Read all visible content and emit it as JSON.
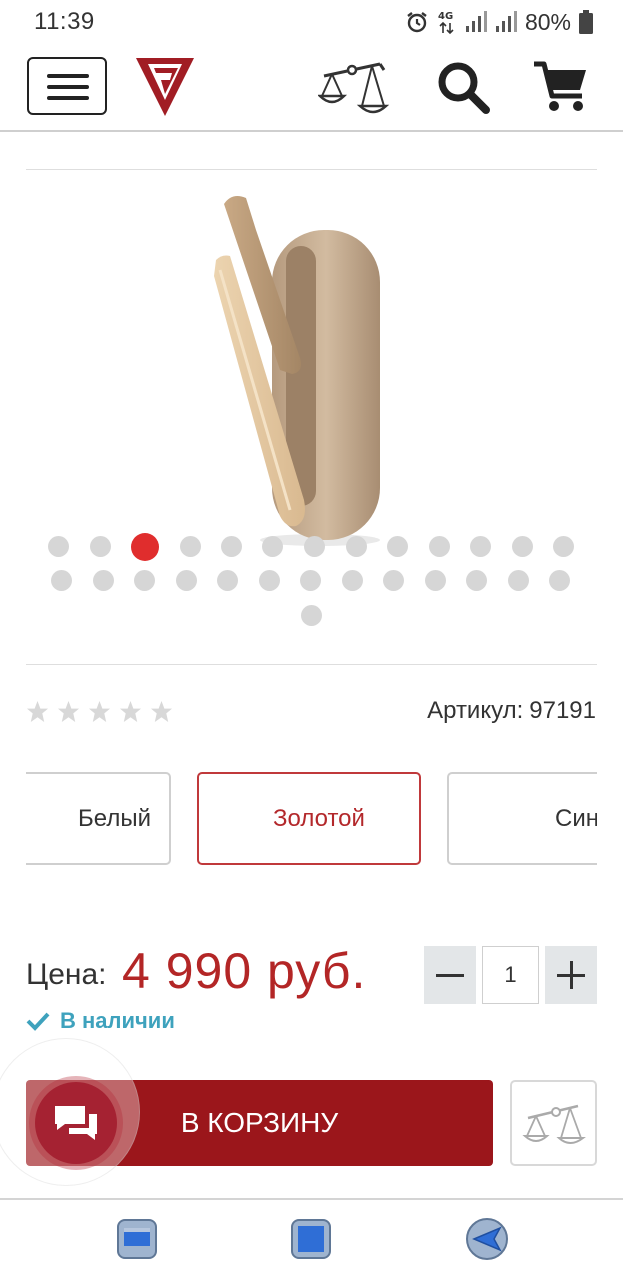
{
  "status_bar": {
    "time": "11:39",
    "network": "4G",
    "battery": "80%",
    "icons": [
      "alarm-icon",
      "signal-icon",
      "signal-icon",
      "battery-icon"
    ]
  },
  "header": {
    "icons": [
      "menu-icon",
      "logo",
      "compare-scales-icon",
      "search-icon",
      "cart-icon"
    ]
  },
  "gallery": {
    "total_slides": 27,
    "active_index": 2,
    "dots_per_row": [
      13,
      13,
      1
    ]
  },
  "product": {
    "rating_stars": 5,
    "rating_value": 0,
    "article_label": "Артикул:",
    "article_value": "97191"
  },
  "variants": [
    {
      "label": "Белый",
      "selected": false
    },
    {
      "label": "Золотой",
      "selected": true
    },
    {
      "label": "Син",
      "selected": false
    }
  ],
  "price": {
    "label": "Цена:",
    "value": "4 990 руб."
  },
  "quantity": {
    "value": "1"
  },
  "availability": {
    "text": "В наличии"
  },
  "actions": {
    "add_to_cart_label": "В КОРЗИНУ"
  },
  "colors": {
    "accent_red": "#9b161b",
    "price_red": "#b32626",
    "active_dot": "#e02d2d",
    "availability_blue": "#3ea2bd"
  }
}
